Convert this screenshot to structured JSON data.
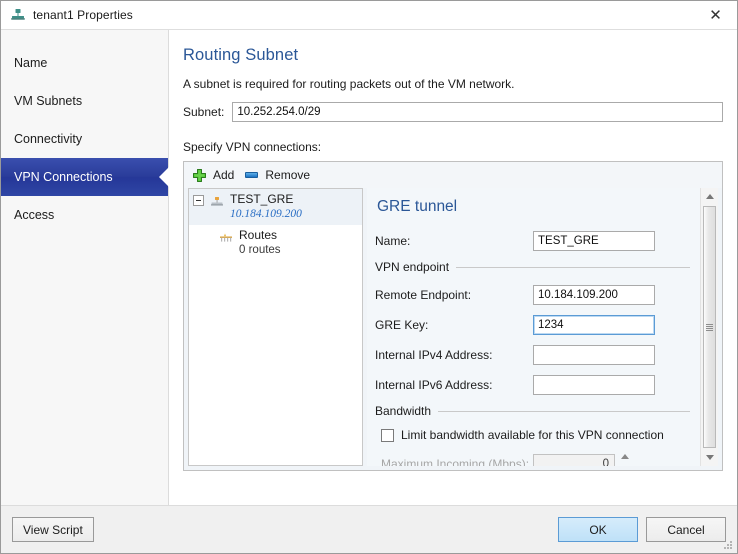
{
  "window": {
    "title": "tenant1 Properties",
    "icon": "network-tenant-icon",
    "close_label": "✕"
  },
  "sidebar": {
    "items": [
      {
        "label": "Name",
        "selected": false
      },
      {
        "label": "VM Subnets",
        "selected": false
      },
      {
        "label": "Connectivity",
        "selected": false
      },
      {
        "label": "VPN Connections",
        "selected": true
      },
      {
        "label": "Access",
        "selected": false
      }
    ]
  },
  "content": {
    "page_title": "Routing Subnet",
    "description": "A subnet is required for routing packets out of the VM network.",
    "subnet_label": "Subnet:",
    "subnet_value": "10.252.254.0/29",
    "subnet_placeholder": "",
    "specify_label": "Specify VPN connections:"
  },
  "toolbar": {
    "add_label": "Add",
    "remove_label": "Remove",
    "add_icon": "plus-icon",
    "remove_icon": "minus-icon"
  },
  "tree": {
    "root": {
      "name": "TEST_GRE",
      "address": "10.184.109.200",
      "icon": "gre-tunnel-icon",
      "expander": "collapse-box"
    },
    "child": {
      "name": "Routes",
      "count": "0 routes",
      "icon": "routes-icon"
    }
  },
  "detail": {
    "title": "GRE tunnel",
    "name_label": "Name:",
    "name_value": "TEST_GRE",
    "endpoint_group": "VPN endpoint",
    "remote_label": "Remote Endpoint:",
    "remote_value": "10.184.109.200",
    "gre_key_label": "GRE Key:",
    "gre_key_value": "1234",
    "ipv4_label": "Internal IPv4 Address:",
    "ipv4_value": "",
    "ipv6_label": "Internal IPv6 Address:",
    "ipv6_value": "",
    "bandwidth_group": "Bandwidth",
    "limit_checkbox_label": "Limit bandwidth available for this VPN connection",
    "limit_checked": false,
    "max_incoming_label": "Maximum Incoming (Mbps):",
    "max_incoming_value": "0",
    "max_incoming_disabled": true
  },
  "footer": {
    "view_script_label": "View Script",
    "ok_label": "OK",
    "cancel_label": "Cancel"
  },
  "colors": {
    "accent_title": "#2b5797",
    "selected_nav": "#2a3c9a",
    "link_blue": "#2a6ec4",
    "add_green": "#4fc134",
    "remove_blue": "#1c72c4"
  }
}
